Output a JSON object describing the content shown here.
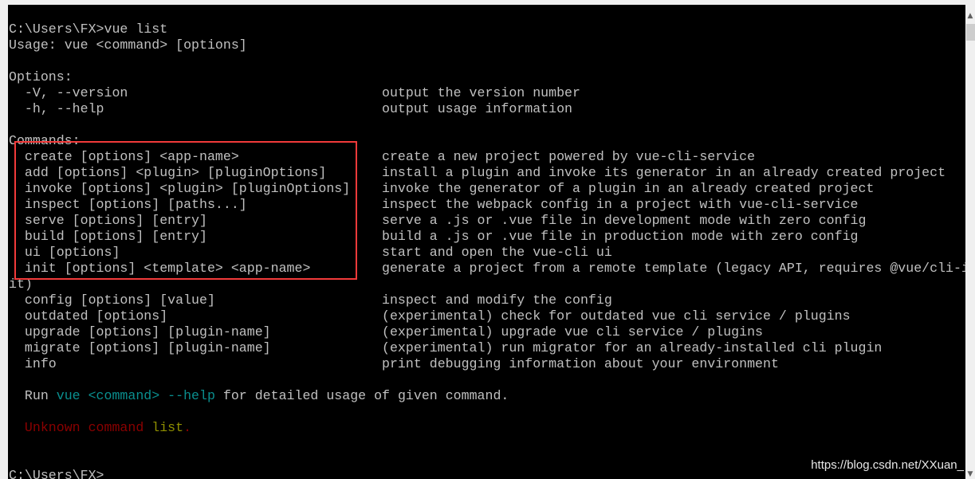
{
  "colors": {
    "default": "#c0c0c0",
    "cyan": "#0a8f8f",
    "red": "#8b0000",
    "yellow": "#8f8f00",
    "highlight_box": "#f23a3a"
  },
  "console": {
    "lines": [
      [
        {
          "t": "C:\\Users\\FX>vue list"
        }
      ],
      [
        {
          "t": "Usage: vue <command> [options]"
        }
      ],
      [],
      [
        {
          "t": "Options:"
        }
      ],
      [
        {
          "t": "  -V, --version                                output the version number"
        }
      ],
      [
        {
          "t": "  -h, --help                                   output usage information"
        }
      ],
      [],
      [
        {
          "t": "Commands:"
        }
      ],
      [
        {
          "t": "  create [options] <app-name>                  create a new project powered by vue-cli-service"
        }
      ],
      [
        {
          "t": "  add [options] <plugin> [pluginOptions]       install a plugin and invoke its generator in an already created project"
        }
      ],
      [
        {
          "t": "  invoke [options] <plugin> [pluginOptions]    invoke the generator of a plugin in an already created project"
        }
      ],
      [
        {
          "t": "  inspect [options] [paths...]                 inspect the webpack config in a project with vue-cli-service"
        }
      ],
      [
        {
          "t": "  serve [options] [entry]                      serve a .js or .vue file in development mode with zero config"
        }
      ],
      [
        {
          "t": "  build [options] [entry]                      build a .js or .vue file in production mode with zero config"
        }
      ],
      [
        {
          "t": "  ui [options]                                 start and open the vue-cli ui"
        }
      ],
      [
        {
          "t": "  init [options] <template> <app-name>         generate a project from a remote template (legacy API, requires @vue/cli-in"
        }
      ],
      [
        {
          "t": "it)"
        }
      ],
      [
        {
          "t": "  config [options] [value]                     inspect and modify the config"
        }
      ],
      [
        {
          "t": "  outdated [options]                           (experimental) check for outdated vue cli service / plugins"
        }
      ],
      [
        {
          "t": "  upgrade [options] [plugin-name]              (experimental) upgrade vue cli service / plugins"
        }
      ],
      [
        {
          "t": "  migrate [options] [plugin-name]              (experimental) run migrator for an already-installed cli plugin"
        }
      ],
      [
        {
          "t": "  info                                         print debugging information about your environment"
        }
      ],
      [],
      [
        {
          "t": "  Run "
        },
        {
          "t": "vue <command> --help",
          "c": "cyan"
        },
        {
          "t": " for detailed usage of given command."
        }
      ],
      [],
      [
        {
          "t": "  Unknown command ",
          "c": "red"
        },
        {
          "t": "list",
          "c": "yellow"
        },
        {
          "t": ".",
          "c": "red"
        }
      ],
      [],
      [],
      [
        {
          "t": "C:\\Users\\FX>"
        }
      ]
    ]
  },
  "watermark": "https://blog.csdn.net/XXuan_",
  "scrollbar": {
    "up_icon": "chevron-up-icon",
    "down_icon": "chevron-down-icon"
  }
}
